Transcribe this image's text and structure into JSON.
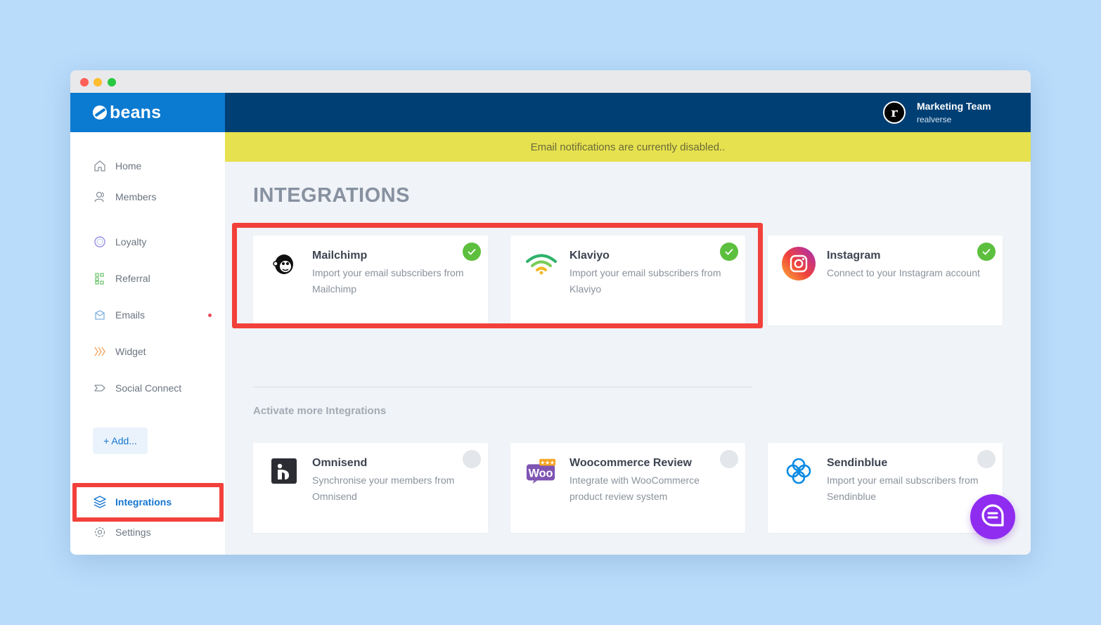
{
  "brand": {
    "name": "beans",
    "color": "#0b7ad1"
  },
  "account": {
    "initial": "r",
    "team": "Marketing Team",
    "store": "realverse"
  },
  "notice": {
    "text": "Email notifications are currently disabled.."
  },
  "sidebar": {
    "items": [
      {
        "label": "Home",
        "icon": "home-icon"
      },
      {
        "label": "Members",
        "icon": "members-icon"
      },
      {
        "label": "Loyalty",
        "icon": "loyalty-icon"
      },
      {
        "label": "Referral",
        "icon": "referral-icon"
      },
      {
        "label": "Emails",
        "icon": "emails-icon",
        "badge": true
      },
      {
        "label": "Widget",
        "icon": "widget-icon"
      },
      {
        "label": "Social Connect",
        "icon": "social-connect-icon"
      }
    ],
    "add_label": "+ Add...",
    "active": {
      "label": "Integrations",
      "icon": "layers-icon"
    },
    "settings": {
      "label": "Settings",
      "icon": "gear-icon"
    }
  },
  "page": {
    "title": "INTEGRATIONS"
  },
  "active_integrations": [
    {
      "name": "Mailchimp",
      "desc": "Import your email subscribers from Mailchimp",
      "status": "active",
      "icon": "mailchimp-logo"
    },
    {
      "name": "Klaviyo",
      "desc": "Import your email subscribers from Klaviyo",
      "status": "active",
      "icon": "klaviyo-logo"
    },
    {
      "name": "Instagram",
      "desc": "Connect to your Instagram account",
      "status": "active",
      "icon": "instagram-logo"
    }
  ],
  "more": {
    "title": "Activate more Integrations",
    "items": [
      {
        "name": "Omnisend",
        "desc": "Synchronise your members from Omnisend",
        "status": "inactive",
        "icon": "omnisend-logo"
      },
      {
        "name": "Woocommerce Review",
        "desc": "Integrate with WooCommerce product review system",
        "status": "inactive",
        "icon": "woocommerce-logo"
      },
      {
        "name": "Sendinblue",
        "desc": "Import your email subscribers from Sendinblue",
        "status": "inactive",
        "icon": "sendinblue-logo"
      }
    ]
  },
  "woo_logo_text": "Woo",
  "colors": {
    "highlight": "#f2403a",
    "topbar": "#003f74",
    "notice": "#e6e14f",
    "check": "#5cbf3d",
    "chat": "#8f2cf0"
  }
}
